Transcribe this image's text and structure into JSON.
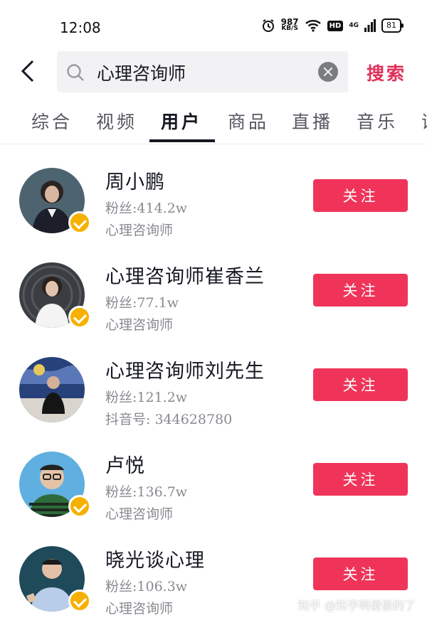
{
  "status_bar": {
    "time": "12:08",
    "net_speed_value": "987",
    "net_speed_unit": "KB/S",
    "hd_label": "HD",
    "signal_label": "4G",
    "battery": "81"
  },
  "search": {
    "query": "心理咨询师",
    "button_label": "搜索"
  },
  "tabs": [
    {
      "label": "综合",
      "active": false
    },
    {
      "label": "视频",
      "active": false
    },
    {
      "label": "用户",
      "active": true
    },
    {
      "label": "商品",
      "active": false
    },
    {
      "label": "直播",
      "active": false
    },
    {
      "label": "音乐",
      "active": false
    },
    {
      "label": "话",
      "active": false
    }
  ],
  "users": [
    {
      "name": "周小鹏",
      "fans": "粉丝:414.2w",
      "desc": "心理咨询师",
      "verified": true,
      "follow_label": "关注"
    },
    {
      "name": "心理咨询师崔香兰",
      "fans": "粉丝:77.1w",
      "desc": "心理咨询师",
      "verified": true,
      "follow_label": "关注"
    },
    {
      "name": "心理咨询师刘先生",
      "fans": "粉丝:121.2w",
      "desc": "抖音号: 344628780",
      "verified": false,
      "follow_label": "关注"
    },
    {
      "name": "卢悦",
      "fans": "粉丝:136.7w",
      "desc": "心理咨询师",
      "verified": true,
      "follow_label": "关注"
    },
    {
      "name": "晓光谈心理",
      "fans": "粉丝:106.3w",
      "desc": "心理咨询师",
      "verified": true,
      "follow_label": "关注"
    }
  ],
  "watermark": "知乎 @知乎啊傻傻的了",
  "colors": {
    "accent": "#e0305a",
    "follow_button": "#f03459",
    "verified_badge": "#f6b100"
  }
}
